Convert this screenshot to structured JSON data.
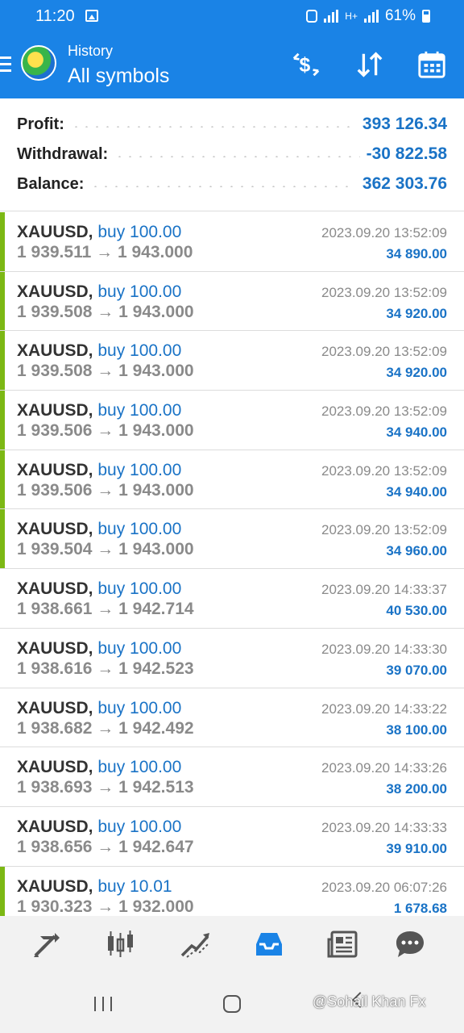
{
  "status_bar": {
    "time": "11:20",
    "battery": "61%",
    "signal_label": "H+"
  },
  "header": {
    "subtitle": "History",
    "title": "All symbols"
  },
  "summary": {
    "profit_label": "Profit:",
    "profit_value": "393 126.34",
    "withdrawal_label": "Withdrawal:",
    "withdrawal_value": "-30 822.58",
    "balance_label": "Balance:",
    "balance_value": "362 303.76"
  },
  "trades": [
    {
      "symbol": "XAUUSD,",
      "side": "buy 100.00",
      "open": "1 939.511",
      "close": "1 943.000",
      "time": "2023.09.20 13:52:09",
      "profit": "34 890.00",
      "marked": true
    },
    {
      "symbol": "XAUUSD,",
      "side": "buy 100.00",
      "open": "1 939.508",
      "close": "1 943.000",
      "time": "2023.09.20 13:52:09",
      "profit": "34 920.00",
      "marked": true
    },
    {
      "symbol": "XAUUSD,",
      "side": "buy 100.00",
      "open": "1 939.508",
      "close": "1 943.000",
      "time": "2023.09.20 13:52:09",
      "profit": "34 920.00",
      "marked": true
    },
    {
      "symbol": "XAUUSD,",
      "side": "buy 100.00",
      "open": "1 939.506",
      "close": "1 943.000",
      "time": "2023.09.20 13:52:09",
      "profit": "34 940.00",
      "marked": true
    },
    {
      "symbol": "XAUUSD,",
      "side": "buy 100.00",
      "open": "1 939.506",
      "close": "1 943.000",
      "time": "2023.09.20 13:52:09",
      "profit": "34 940.00",
      "marked": true
    },
    {
      "symbol": "XAUUSD,",
      "side": "buy 100.00",
      "open": "1 939.504",
      "close": "1 943.000",
      "time": "2023.09.20 13:52:09",
      "profit": "34 960.00",
      "marked": true
    },
    {
      "symbol": "XAUUSD,",
      "side": "buy 100.00",
      "open": "1 938.661",
      "close": "1 942.714",
      "time": "2023.09.20 14:33:37",
      "profit": "40 530.00",
      "marked": false
    },
    {
      "symbol": "XAUUSD,",
      "side": "buy 100.00",
      "open": "1 938.616",
      "close": "1 942.523",
      "time": "2023.09.20 14:33:30",
      "profit": "39 070.00",
      "marked": false
    },
    {
      "symbol": "XAUUSD,",
      "side": "buy 100.00",
      "open": "1 938.682",
      "close": "1 942.492",
      "time": "2023.09.20 14:33:22",
      "profit": "38 100.00",
      "marked": false
    },
    {
      "symbol": "XAUUSD,",
      "side": "buy 100.00",
      "open": "1 938.693",
      "close": "1 942.513",
      "time": "2023.09.20 14:33:26",
      "profit": "38 200.00",
      "marked": false
    },
    {
      "symbol": "XAUUSD,",
      "side": "buy 100.00",
      "open": "1 938.656",
      "close": "1 942.647",
      "time": "2023.09.20 14:33:33",
      "profit": "39 910.00",
      "marked": false
    },
    {
      "symbol": "XAUUSD,",
      "side": "buy 10.01",
      "open": "1 930.323",
      "close": "1 932.000",
      "time": "2023.09.20 06:07:26",
      "profit": "1 678.68",
      "marked": true
    }
  ],
  "arrow": "→",
  "bottom_nav": [
    "quotes-icon",
    "chart-icon",
    "trade-icon",
    "history-icon",
    "news-icon",
    "chat-icon"
  ],
  "colors": {
    "header_bg": "#1a83e6",
    "accent_blue": "#1a73c6",
    "marker_green": "#7cb814"
  },
  "watermark": "@Sohail Khan Fx"
}
